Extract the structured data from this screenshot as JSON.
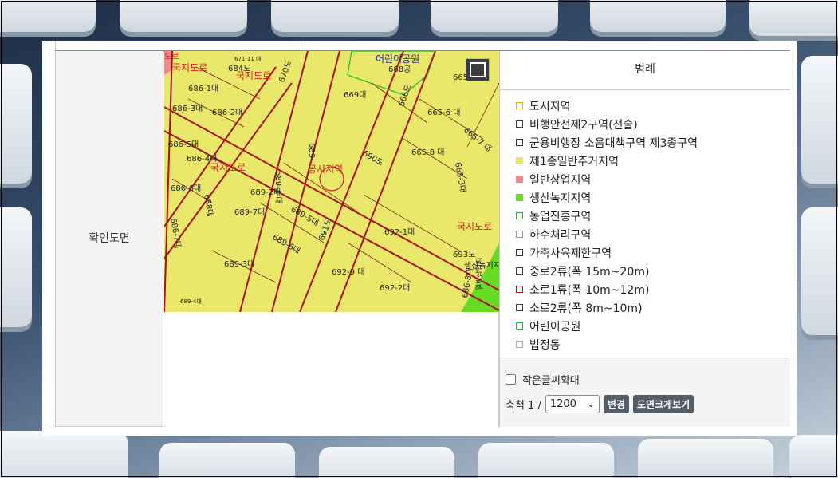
{
  "row_label": "확인도면",
  "legend": {
    "title": "범례",
    "items": [
      {
        "label": "도시지역",
        "color": "#e0b800",
        "fill": "none"
      },
      {
        "label": "비행안전제2구역(전술)",
        "color": "#2a3a7a",
        "fill": "none"
      },
      {
        "label": "군용비행장 소음대책구역 제3종구역",
        "color": "#333333",
        "fill": "none"
      },
      {
        "label": "제1종일반주거지역",
        "color": "#e8e46a",
        "fill": "#e8e46a"
      },
      {
        "label": "일반상업지역",
        "color": "#f08a8a",
        "fill": "#f08a8a"
      },
      {
        "label": "생산녹지지역",
        "color": "#66dd22",
        "fill": "#66dd22"
      },
      {
        "label": "농업진흥구역",
        "color": "#33aa33",
        "fill": "none"
      },
      {
        "label": "하수처리구역",
        "color": "#999999",
        "fill": "none"
      },
      {
        "label": "가축사육제한구역",
        "color": "#333333",
        "fill": "none"
      },
      {
        "label": "중로2류(폭 15m~20m)",
        "color": "#aa1111",
        "fill": "none"
      },
      {
        "label": "소로1류(폭 10m~12m)",
        "color": "#aa1111",
        "fill": "none"
      },
      {
        "label": "소로2류(폭 8m~10m)",
        "color": "#aa1111",
        "fill": "none"
      },
      {
        "label": "어린이공원",
        "color": "#22bb22",
        "fill": "none"
      },
      {
        "label": "법정동",
        "color": "#aaaaaa",
        "fill": "none"
      }
    ]
  },
  "controls": {
    "small_text_label": "작은글씨확대",
    "small_text_checked": false,
    "scale_label": "축척 1 /",
    "scale_value": "1200",
    "change_button": "변경",
    "large_view_button": "도면크게보기"
  },
  "map": {
    "parcel_labels": [
      "686-1대",
      "684도",
      "670도",
      "669대",
      "668공",
      "665대",
      "686-3대",
      "686-2대",
      "665-6 대",
      "666도",
      "686-5대",
      "689-1 대",
      "689-",
      "690도",
      "665-8 대",
      "665-7 대",
      "686-4대",
      "665-3대",
      "686-6대",
      "689-2대",
      "688대",
      "689-5대",
      "689-7대",
      "689-6대",
      "692-1대",
      "686-7대",
      "691도",
      "689-3대",
      "693도",
      "692-9 대",
      "692-2대",
      "689-4대",
      "686-8대",
      "671-11 대"
    ],
    "overlay_labels": [
      "국지도로",
      "국지도로",
      "국지도로",
      "국지도로",
      "어린이공원",
      "생산녹지지",
      "일반상업지",
      "공시지역",
      "도로"
    ]
  }
}
